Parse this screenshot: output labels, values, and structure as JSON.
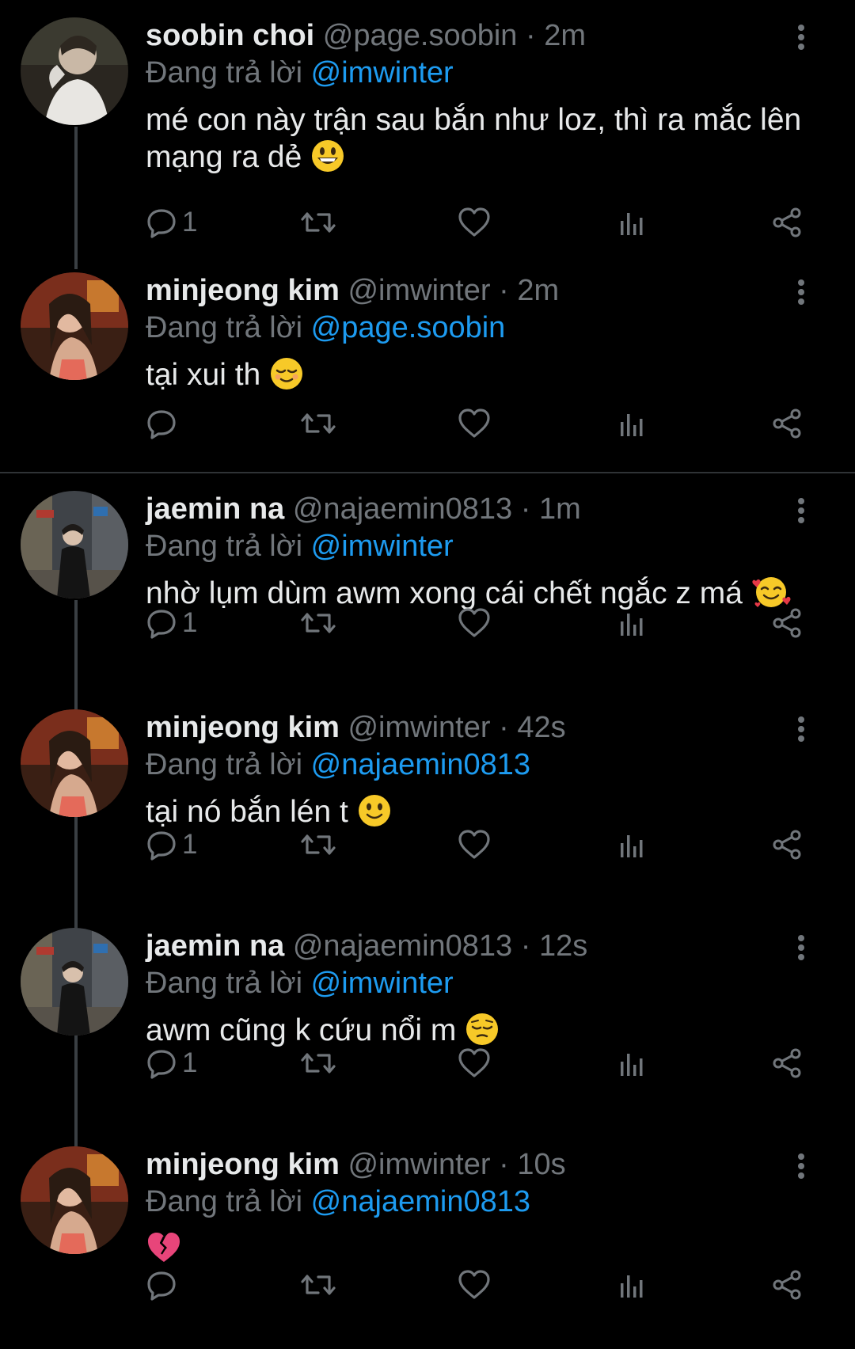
{
  "reply_prefix": "Đang trả lời",
  "tweets": [
    {
      "name": "soobin choi",
      "handle": "@page.soobin",
      "time": "2m",
      "reply_to": "@imwinter",
      "text": "mé con này trận sau bắn như loz, thì ra mắc lên mạng ra dẻ",
      "emoji": "grinning-face",
      "reply_count": "1"
    },
    {
      "name": "minjeong kim",
      "handle": "@imwinter",
      "time": "2m",
      "reply_to": "@page.soobin",
      "text": "tại xui th",
      "emoji": "relieved-face",
      "reply_count": ""
    },
    {
      "name": "jaemin na",
      "handle": "@najaemin0813",
      "time": "1m",
      "reply_to": "@imwinter",
      "text": "nhờ lụm dùm awm xong cái chết ngắc z má",
      "emoji": "smiling-face-with-hearts",
      "reply_count": "1"
    },
    {
      "name": "minjeong kim",
      "handle": "@imwinter",
      "time": "42s",
      "reply_to": "@najaemin0813",
      "text": "tại nó bắn lén t",
      "emoji": "slightly-smiling-face",
      "reply_count": "1"
    },
    {
      "name": "jaemin na",
      "handle": "@najaemin0813",
      "time": "12s",
      "reply_to": "@imwinter",
      "text": "awm cũng k cứu nổi m",
      "emoji": "pensive-face",
      "reply_count": "1"
    },
    {
      "name": "minjeong kim",
      "handle": "@imwinter",
      "time": "10s",
      "reply_to": "@najaemin0813",
      "text": "",
      "emoji": "broken-heart",
      "reply_count": ""
    }
  ],
  "icons": {
    "reply": "reply-icon",
    "retweet": "retweet-icon",
    "like": "heart-icon",
    "views": "views-icon",
    "share": "share-icon",
    "more": "more-icon"
  },
  "colors": {
    "background": "#000000",
    "text": "#e7e9ea",
    "secondary": "#71767b",
    "link": "#1d9bf0",
    "divider": "#2f3336"
  }
}
